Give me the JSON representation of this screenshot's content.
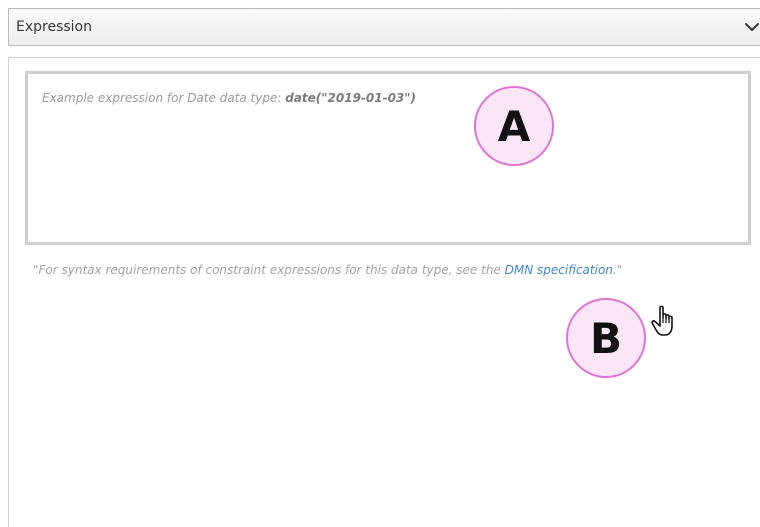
{
  "section": {
    "title": "Expression",
    "chevron_icon": "chevron-down-icon"
  },
  "expression_field": {
    "placeholder_prefix": "Example expression for Date data type: ",
    "placeholder_example": "date(\"2019-01-03\")",
    "value": ""
  },
  "help": {
    "text_before": "\"For syntax requirements of constraint expressions for this data type, see the ",
    "link_label": "DMN specification",
    "text_after": ".\""
  },
  "callouts": {
    "a_label": "A",
    "b_label": "B",
    "color": "#e072d6",
    "fill": "#fbe6f8"
  },
  "colors": {
    "link": "#3d87cf"
  },
  "cursor_icon": "hand-pointer-icon"
}
